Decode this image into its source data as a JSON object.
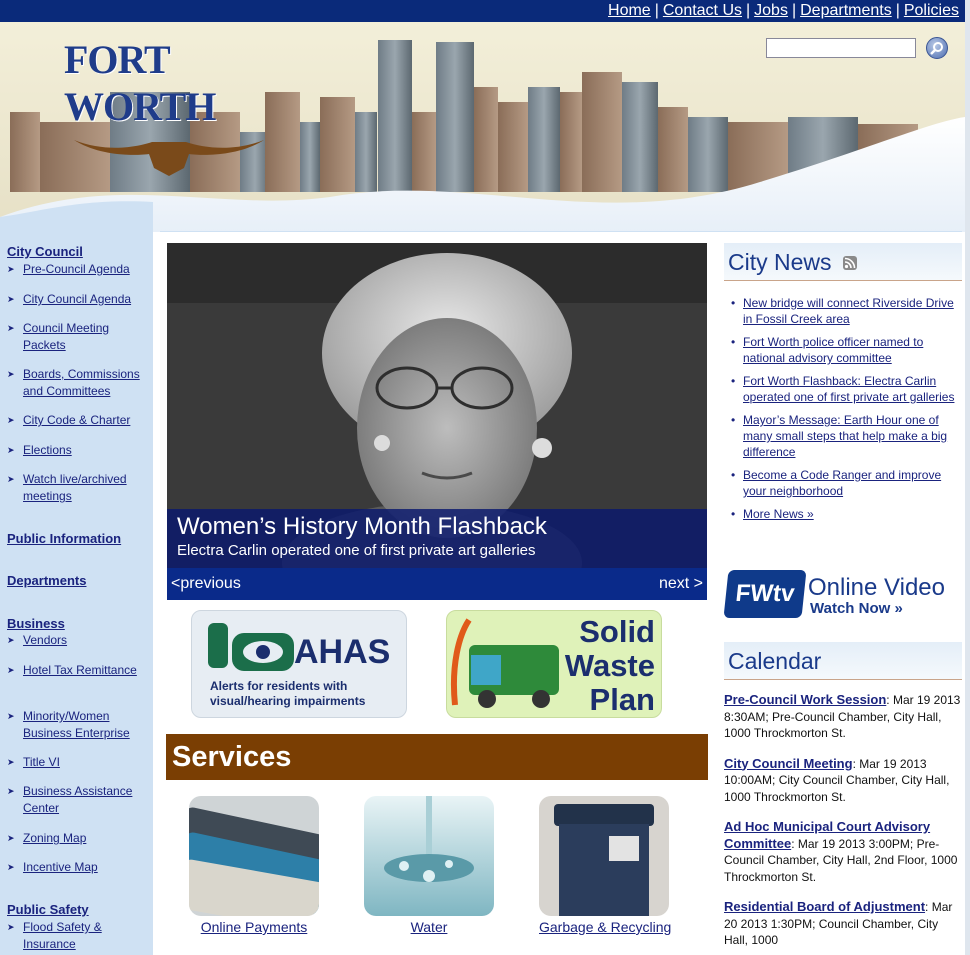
{
  "topnav": {
    "links": [
      "Home",
      "Contact Us",
      "Jobs",
      "Departments",
      "Policies"
    ]
  },
  "header": {
    "logo_text": "FORT WORTH",
    "search_placeholder": ""
  },
  "leftnav": {
    "city_council": "City Council",
    "items_council": [
      "Pre-Council Agenda",
      "City Council Agenda",
      "Council Meeting Packets",
      "Boards, Commissions and Committees",
      "City Code & Charter",
      "Elections",
      "Watch live/archived meetings"
    ],
    "public_information": "Public Information",
    "departments": "Departments",
    "business": "Business",
    "items_business": [
      "Vendors",
      "Hotel Tax Remittance",
      "Minority/Women Business Enterprise",
      "Title VI",
      "Business Assistance Center",
      "Zoning Map",
      "Incentive Map"
    ],
    "public_safety": "Public Safety",
    "items_safety": [
      "Flood Safety & Insurance"
    ]
  },
  "hero": {
    "title": "Women’s History Month Flashback",
    "subtitle": "Electra Carlin operated one of first private art galleries",
    "prev": "<previous",
    "next": "next >"
  },
  "promos": {
    "ahas_title": "AHAS",
    "ahas_sub": "Alerts for residents with visual/hearing impairments",
    "waste_title": "Solid Waste Plan"
  },
  "services": {
    "heading": "Services",
    "items": [
      "Online Payments",
      "Water",
      "Garbage & Recycling"
    ]
  },
  "news": {
    "heading": "City News",
    "items": [
      "New bridge will connect Riverside Drive in Fossil Creek area",
      "Fort Worth police officer named to national advisory committee",
      "Fort Worth Flashback: Electra Carlin operated one of first private art galleries",
      "Mayor’s Message: Earth Hour one of many small steps that help make a big difference",
      "Become a Code Ranger and improve your neighborhood",
      "More News »"
    ]
  },
  "video": {
    "logo": "FWtv",
    "title": "Online Video",
    "cta": "Watch Now »"
  },
  "calendar": {
    "heading": "Calendar",
    "events": [
      {
        "name": "Pre-Council Work Session",
        "detail": ": Mar 19 2013 8:30AM; Pre-Council Chamber, City Hall, 1000 Throckmorton St."
      },
      {
        "name": "City Council Meeting",
        "detail": ": Mar 19 2013 10:00AM; City Council Chamber, City Hall, 1000 Throckmorton St."
      },
      {
        "name": "Ad Hoc Municipal Court Advisory Committee",
        "detail": ": Mar 19 2013 3:00PM; Pre-Council Chamber, City Hall, 2nd Floor, 1000 Throckmorton St."
      },
      {
        "name": "Residential Board of Adjustment",
        "detail": ": Mar 20 2013 1:30PM; Council Chamber, City Hall, 1000"
      }
    ]
  },
  "colors": {
    "topbar": "#0a2a7a",
    "services_bar": "#7a3e03",
    "link": "#1a237e",
    "sidebar": "#cfe1f3"
  }
}
